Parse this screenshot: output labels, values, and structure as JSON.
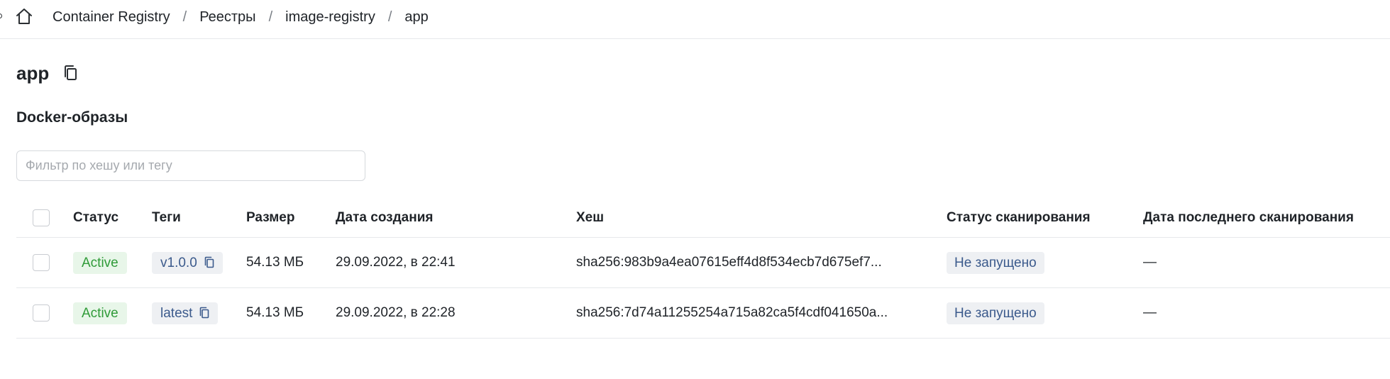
{
  "icons": {
    "home": "home-icon",
    "copy": "copy-icon"
  },
  "breadcrumb": {
    "items": [
      {
        "label": "Container Registry"
      },
      {
        "label": "Реестры"
      },
      {
        "label": "image-registry"
      },
      {
        "label": "app"
      }
    ],
    "separator": "/"
  },
  "page": {
    "title": "app",
    "section_title": "Docker-образы"
  },
  "filter": {
    "placeholder": "Фильтр по хешу или тегу",
    "value": ""
  },
  "table": {
    "columns": {
      "status": "Статус",
      "tags": "Теги",
      "size": "Размер",
      "created": "Дата создания",
      "hash": "Хеш",
      "scan_status": "Статус сканирования",
      "last_scan": "Дата последнего сканирования"
    },
    "rows": [
      {
        "status": "Active",
        "tag": "v1.0.0",
        "size": "54.13 МБ",
        "created": "29.09.2022, в 22:41",
        "hash": "sha256:983b9a4ea07615eff4d8f534ecb7d675ef7...",
        "scan_status": "Не запущено",
        "last_scan": "—"
      },
      {
        "status": "Active",
        "tag": "latest",
        "size": "54.13 МБ",
        "created": "29.09.2022, в 22:28",
        "hash": "sha256:7d74a11255254a715a82ca5f4cdf041650a...",
        "scan_status": "Не запущено",
        "last_scan": "—"
      }
    ]
  },
  "colors": {
    "active_badge_bg": "#e8f6e9",
    "active_badge_text": "#2f9b38",
    "neutral_badge_bg": "#eef0f3",
    "neutral_badge_text": "#3b5a8c",
    "divider": "#e6e8eb"
  }
}
